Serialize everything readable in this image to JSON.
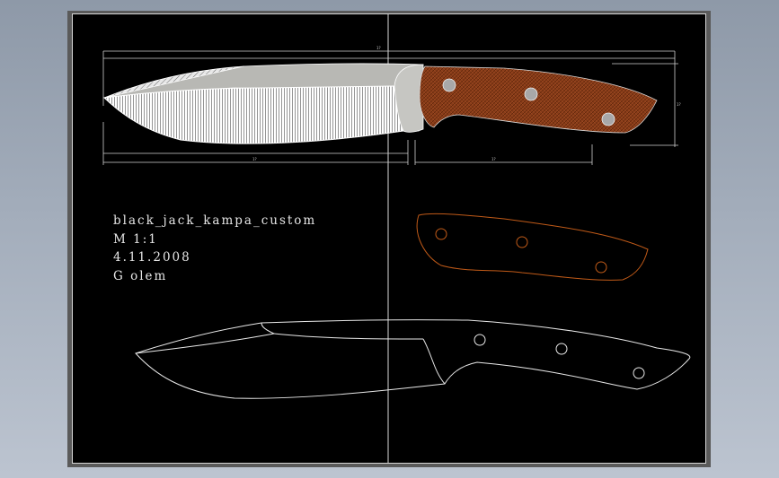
{
  "drawing": {
    "part_name": "black_jack_kampa_custom",
    "scale": "M  1:1",
    "date": "4.11.2008",
    "author": "G olem"
  },
  "dimensions": {
    "overall_length": "1?",
    "blade_length": "1?",
    "handle_length": "1?",
    "height": "1?"
  },
  "colors": {
    "background": "#000000",
    "handle_wood": "#8a3d1a",
    "handle_outline_orange": "#c05a18",
    "blade_fill": "#b0b0b0",
    "lines": "#e8e8e8"
  }
}
